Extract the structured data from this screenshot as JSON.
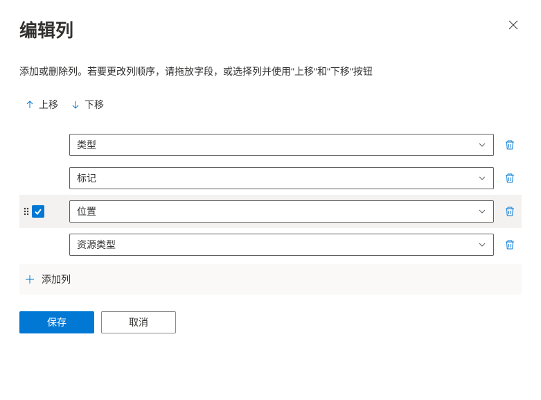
{
  "header": {
    "title": "编辑列"
  },
  "description": "添加或删除列。若要更改列顺序，请拖放字段，或选择列并使用\"上移\"和\"下移\"按钮",
  "moveControls": {
    "upLabel": "上移",
    "downLabel": "下移"
  },
  "columns": [
    {
      "label": "类型",
      "selected": false
    },
    {
      "label": "标记",
      "selected": false
    },
    {
      "label": "位置",
      "selected": true
    },
    {
      "label": "资源类型",
      "selected": false
    }
  ],
  "addColumn": {
    "label": "添加列"
  },
  "footer": {
    "saveLabel": "保存",
    "cancelLabel": "取消"
  }
}
